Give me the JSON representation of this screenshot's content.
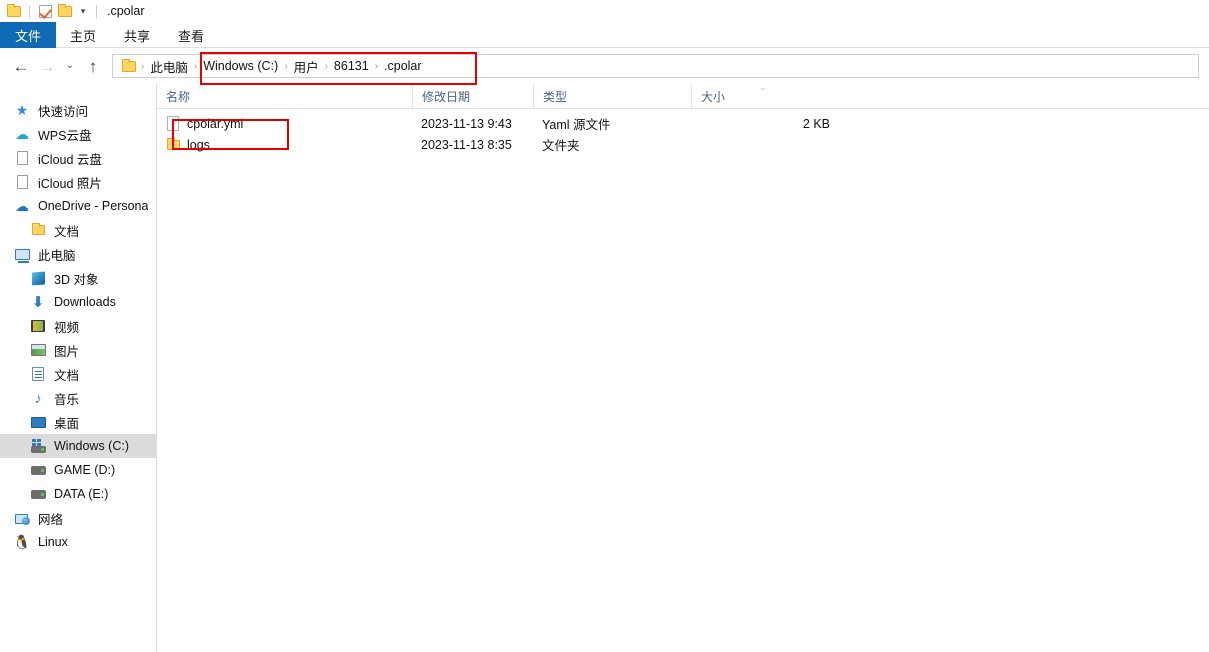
{
  "window": {
    "title": ".cpolar",
    "quick_access": {
      "folder_icon": "folder-icon",
      "properties_icon": "properties-checkbox-icon",
      "new_folder_icon": "new-folder-icon",
      "customize_caret": "▾"
    }
  },
  "ribbon": {
    "tabs": [
      {
        "label": "文件",
        "active": true
      },
      {
        "label": "主页",
        "active": false
      },
      {
        "label": "共享",
        "active": false
      },
      {
        "label": "查看",
        "active": false
      }
    ],
    "active_tab_color": "#1069b5"
  },
  "navbar": {
    "back": "←",
    "forward": "→",
    "recent": "⌄",
    "up": "↑",
    "breadcrumb": [
      "此电脑",
      "Windows (C:)",
      "用户",
      "86131",
      ".cpolar"
    ],
    "separator": "›"
  },
  "sidebar": {
    "items": [
      {
        "label": "快速访问",
        "icon": "star-icon",
        "indent": 0,
        "selected": false
      },
      {
        "label": "WPS云盘",
        "icon": "cloud-icon",
        "indent": 0,
        "selected": false
      },
      {
        "label": "iCloud 云盘",
        "icon": "document-icon",
        "indent": 0,
        "selected": false
      },
      {
        "label": "iCloud 照片",
        "icon": "document-icon",
        "indent": 0,
        "selected": false
      },
      {
        "label": "OneDrive - Persona",
        "icon": "onedrive-cloud-icon",
        "indent": 0,
        "selected": false
      },
      {
        "label": "文档",
        "icon": "folder-icon",
        "indent": 1,
        "selected": false
      },
      {
        "label": "此电脑",
        "icon": "this-pc-icon",
        "indent": 0,
        "selected": false
      },
      {
        "label": "3D 对象",
        "icon": "3d-objects-icon",
        "indent": 1,
        "selected": false
      },
      {
        "label": "Downloads",
        "icon": "downloads-icon",
        "indent": 1,
        "selected": false
      },
      {
        "label": "视频",
        "icon": "videos-icon",
        "indent": 1,
        "selected": false
      },
      {
        "label": "图片",
        "icon": "pictures-icon",
        "indent": 1,
        "selected": false
      },
      {
        "label": "文档",
        "icon": "documents-icon",
        "indent": 1,
        "selected": false
      },
      {
        "label": "音乐",
        "icon": "music-icon",
        "indent": 1,
        "selected": false
      },
      {
        "label": "桌面",
        "icon": "desktop-icon",
        "indent": 1,
        "selected": false
      },
      {
        "label": "Windows (C:)",
        "icon": "windows-drive-icon",
        "indent": 1,
        "selected": true
      },
      {
        "label": "GAME (D:)",
        "icon": "drive-icon",
        "indent": 1,
        "selected": false
      },
      {
        "label": "DATA (E:)",
        "icon": "drive-icon",
        "indent": 1,
        "selected": false
      },
      {
        "label": "网络",
        "icon": "network-icon",
        "indent": 0,
        "selected": false
      },
      {
        "label": "Linux",
        "icon": "linux-penguin-icon",
        "indent": 0,
        "selected": false
      }
    ],
    "selected_bg": "#dcdcdc"
  },
  "file_list": {
    "columns": [
      {
        "label": "名称",
        "sorted": false
      },
      {
        "label": "修改日期",
        "sorted": false
      },
      {
        "label": "类型",
        "sorted": false
      },
      {
        "label": "大小",
        "sorted": true
      }
    ],
    "sort_indicator": "⌄",
    "rows": [
      {
        "name": "cpolar.yml",
        "icon": "yaml-file-icon",
        "date_modified": "2023-11-13 9:43",
        "type": "Yaml 源文件",
        "size": "2 KB"
      },
      {
        "name": "logs",
        "icon": "folder-icon",
        "date_modified": "2023-11-13 8:35",
        "type": "文件夹",
        "size": ""
      }
    ]
  },
  "annotations": {
    "color": "#e60000",
    "boxes": [
      {
        "name": "address-path-highlight",
        "target": "breadcrumb-path"
      },
      {
        "name": "filename-highlight",
        "target": "cpolar-yml-row-name"
      }
    ]
  }
}
